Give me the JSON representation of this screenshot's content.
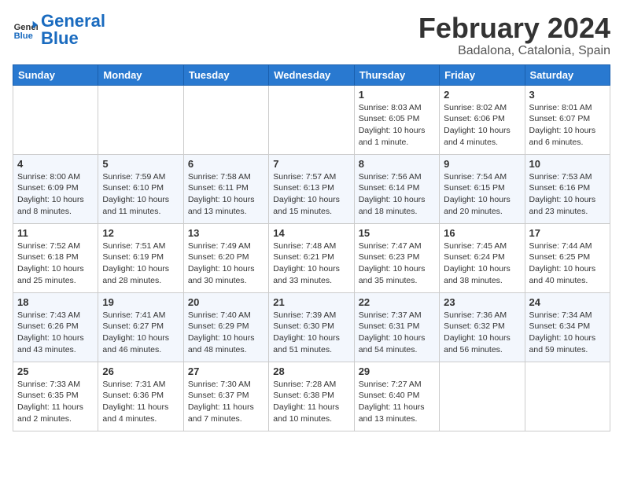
{
  "header": {
    "logo_general": "General",
    "logo_blue": "Blue",
    "month_year": "February 2024",
    "location": "Badalona, Catalonia, Spain"
  },
  "days_of_week": [
    "Sunday",
    "Monday",
    "Tuesday",
    "Wednesday",
    "Thursday",
    "Friday",
    "Saturday"
  ],
  "weeks": [
    [
      {
        "day": "",
        "info": ""
      },
      {
        "day": "",
        "info": ""
      },
      {
        "day": "",
        "info": ""
      },
      {
        "day": "",
        "info": ""
      },
      {
        "day": "1",
        "info": "Sunrise: 8:03 AM\nSunset: 6:05 PM\nDaylight: 10 hours\nand 1 minute."
      },
      {
        "day": "2",
        "info": "Sunrise: 8:02 AM\nSunset: 6:06 PM\nDaylight: 10 hours\nand 4 minutes."
      },
      {
        "day": "3",
        "info": "Sunrise: 8:01 AM\nSunset: 6:07 PM\nDaylight: 10 hours\nand 6 minutes."
      }
    ],
    [
      {
        "day": "4",
        "info": "Sunrise: 8:00 AM\nSunset: 6:09 PM\nDaylight: 10 hours\nand 8 minutes."
      },
      {
        "day": "5",
        "info": "Sunrise: 7:59 AM\nSunset: 6:10 PM\nDaylight: 10 hours\nand 11 minutes."
      },
      {
        "day": "6",
        "info": "Sunrise: 7:58 AM\nSunset: 6:11 PM\nDaylight: 10 hours\nand 13 minutes."
      },
      {
        "day": "7",
        "info": "Sunrise: 7:57 AM\nSunset: 6:13 PM\nDaylight: 10 hours\nand 15 minutes."
      },
      {
        "day": "8",
        "info": "Sunrise: 7:56 AM\nSunset: 6:14 PM\nDaylight: 10 hours\nand 18 minutes."
      },
      {
        "day": "9",
        "info": "Sunrise: 7:54 AM\nSunset: 6:15 PM\nDaylight: 10 hours\nand 20 minutes."
      },
      {
        "day": "10",
        "info": "Sunrise: 7:53 AM\nSunset: 6:16 PM\nDaylight: 10 hours\nand 23 minutes."
      }
    ],
    [
      {
        "day": "11",
        "info": "Sunrise: 7:52 AM\nSunset: 6:18 PM\nDaylight: 10 hours\nand 25 minutes."
      },
      {
        "day": "12",
        "info": "Sunrise: 7:51 AM\nSunset: 6:19 PM\nDaylight: 10 hours\nand 28 minutes."
      },
      {
        "day": "13",
        "info": "Sunrise: 7:49 AM\nSunset: 6:20 PM\nDaylight: 10 hours\nand 30 minutes."
      },
      {
        "day": "14",
        "info": "Sunrise: 7:48 AM\nSunset: 6:21 PM\nDaylight: 10 hours\nand 33 minutes."
      },
      {
        "day": "15",
        "info": "Sunrise: 7:47 AM\nSunset: 6:23 PM\nDaylight: 10 hours\nand 35 minutes."
      },
      {
        "day": "16",
        "info": "Sunrise: 7:45 AM\nSunset: 6:24 PM\nDaylight: 10 hours\nand 38 minutes."
      },
      {
        "day": "17",
        "info": "Sunrise: 7:44 AM\nSunset: 6:25 PM\nDaylight: 10 hours\nand 40 minutes."
      }
    ],
    [
      {
        "day": "18",
        "info": "Sunrise: 7:43 AM\nSunset: 6:26 PM\nDaylight: 10 hours\nand 43 minutes."
      },
      {
        "day": "19",
        "info": "Sunrise: 7:41 AM\nSunset: 6:27 PM\nDaylight: 10 hours\nand 46 minutes."
      },
      {
        "day": "20",
        "info": "Sunrise: 7:40 AM\nSunset: 6:29 PM\nDaylight: 10 hours\nand 48 minutes."
      },
      {
        "day": "21",
        "info": "Sunrise: 7:39 AM\nSunset: 6:30 PM\nDaylight: 10 hours\nand 51 minutes."
      },
      {
        "day": "22",
        "info": "Sunrise: 7:37 AM\nSunset: 6:31 PM\nDaylight: 10 hours\nand 54 minutes."
      },
      {
        "day": "23",
        "info": "Sunrise: 7:36 AM\nSunset: 6:32 PM\nDaylight: 10 hours\nand 56 minutes."
      },
      {
        "day": "24",
        "info": "Sunrise: 7:34 AM\nSunset: 6:34 PM\nDaylight: 10 hours\nand 59 minutes."
      }
    ],
    [
      {
        "day": "25",
        "info": "Sunrise: 7:33 AM\nSunset: 6:35 PM\nDaylight: 11 hours\nand 2 minutes."
      },
      {
        "day": "26",
        "info": "Sunrise: 7:31 AM\nSunset: 6:36 PM\nDaylight: 11 hours\nand 4 minutes."
      },
      {
        "day": "27",
        "info": "Sunrise: 7:30 AM\nSunset: 6:37 PM\nDaylight: 11 hours\nand 7 minutes."
      },
      {
        "day": "28",
        "info": "Sunrise: 7:28 AM\nSunset: 6:38 PM\nDaylight: 11 hours\nand 10 minutes."
      },
      {
        "day": "29",
        "info": "Sunrise: 7:27 AM\nSunset: 6:40 PM\nDaylight: 11 hours\nand 13 minutes."
      },
      {
        "day": "",
        "info": ""
      },
      {
        "day": "",
        "info": ""
      }
    ]
  ]
}
